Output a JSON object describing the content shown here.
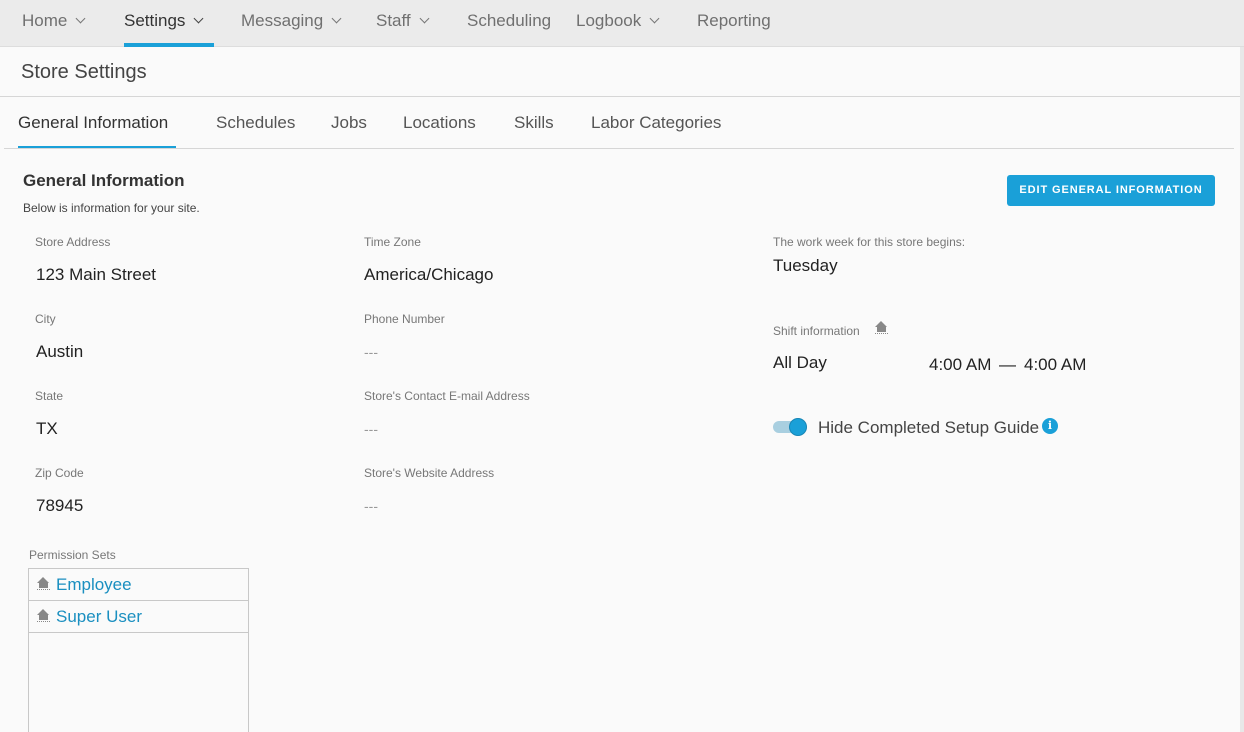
{
  "nav": {
    "items": [
      {
        "label": "Home",
        "dropdown": true
      },
      {
        "label": "Settings",
        "dropdown": true,
        "active": true
      },
      {
        "label": "Messaging",
        "dropdown": true
      },
      {
        "label": "Staff",
        "dropdown": true
      },
      {
        "label": "Scheduling",
        "dropdown": false
      },
      {
        "label": "Logbook",
        "dropdown": true
      },
      {
        "label": "Reporting",
        "dropdown": false
      }
    ]
  },
  "page": {
    "title": "Store Settings"
  },
  "tabs": [
    {
      "label": "General Information",
      "active": true
    },
    {
      "label": "Schedules"
    },
    {
      "label": "Jobs"
    },
    {
      "label": "Locations"
    },
    {
      "label": "Skills"
    },
    {
      "label": "Labor Categories"
    }
  ],
  "section": {
    "title": "General Information",
    "subtitle": "Below is information for your site.",
    "edit_button": "EDIT GENERAL INFORMATION"
  },
  "fields": {
    "store_address": {
      "label": "Store Address",
      "value": "123 Main Street"
    },
    "city": {
      "label": "City",
      "value": "Austin"
    },
    "state": {
      "label": "State",
      "value": "TX"
    },
    "zip": {
      "label": "Zip Code",
      "value": "78945"
    },
    "time_zone": {
      "label": "Time Zone",
      "value": "America/Chicago"
    },
    "phone": {
      "label": "Phone Number",
      "value": "---"
    },
    "email": {
      "label": "Store's Contact E-mail Address",
      "value": "---"
    },
    "website": {
      "label": "Store's Website Address",
      "value": "---"
    },
    "work_week": {
      "label": "The work week for this store begins:",
      "value": "Tuesday"
    }
  },
  "shift": {
    "label": "Shift information",
    "icon": "house-icon",
    "name": "All Day",
    "start": "4:00 AM",
    "separator": "—",
    "end": "4:00 AM"
  },
  "setup_guide": {
    "label": "Hide Completed Setup Guide",
    "enabled": true,
    "info_icon": "i"
  },
  "permissions": {
    "label": "Permission Sets",
    "items": [
      {
        "name": "Employee",
        "icon": "house-icon"
      },
      {
        "name": "Super User",
        "icon": "house-icon"
      }
    ]
  },
  "colors": {
    "accent": "#1aa0d8",
    "link": "#1a8fc0",
    "nav_bg": "#ebebeb"
  }
}
